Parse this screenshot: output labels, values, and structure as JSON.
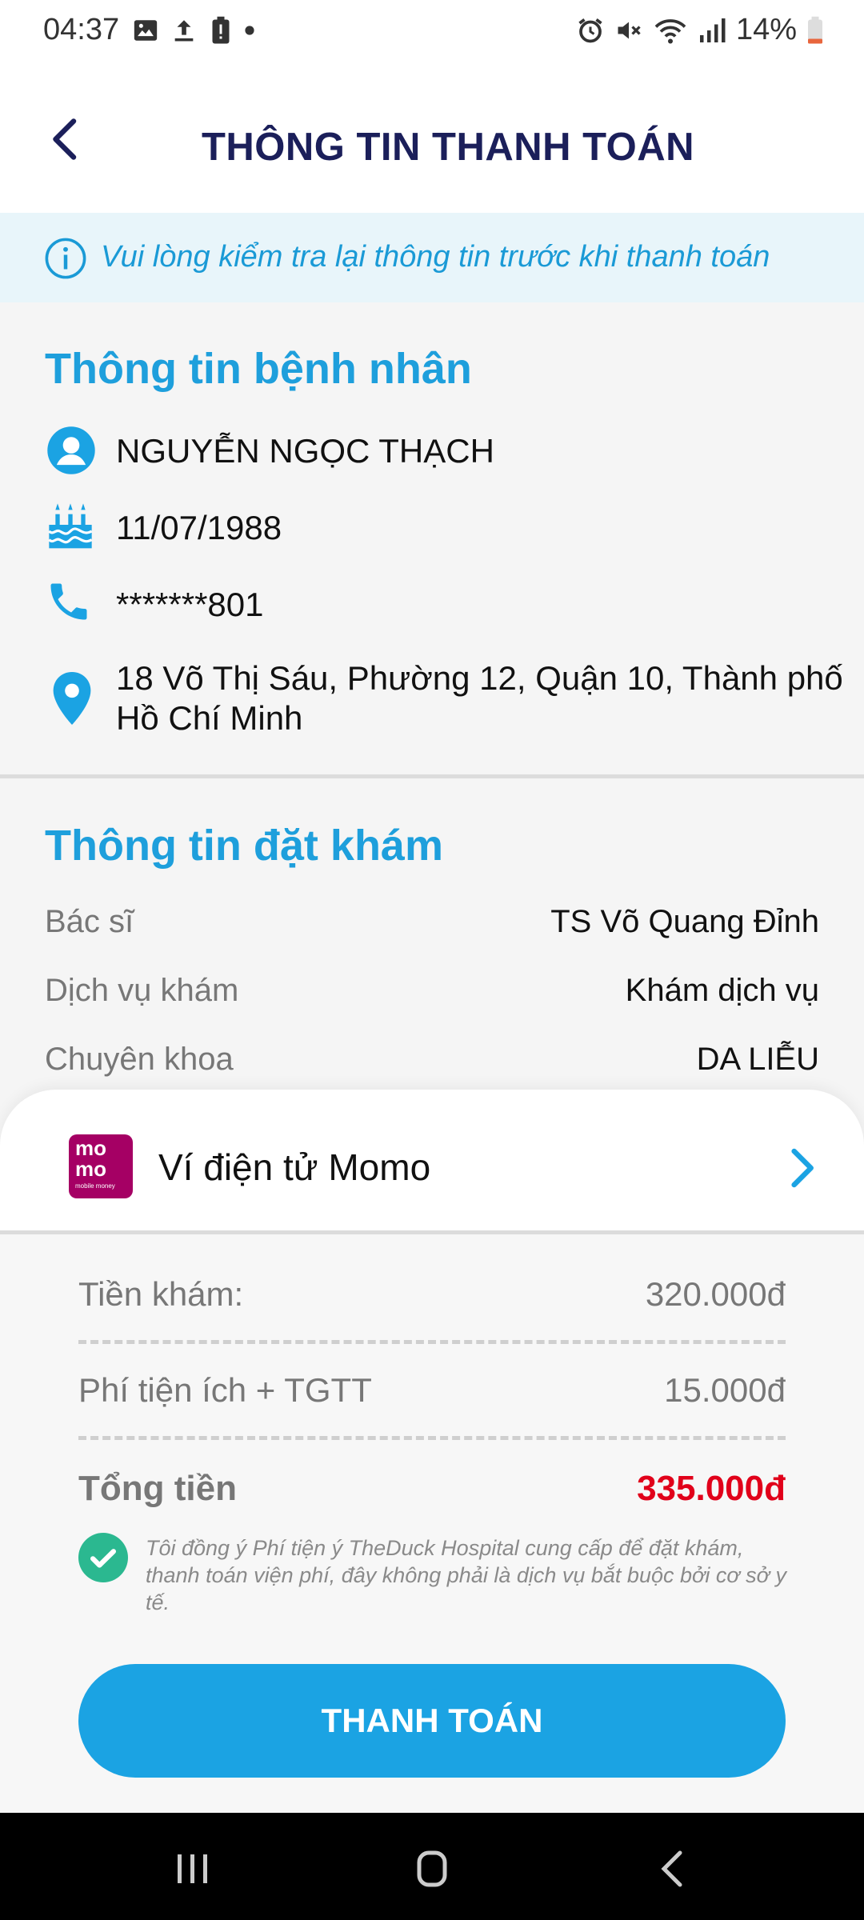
{
  "status_bar": {
    "time": "04:37",
    "battery_percent": "14%",
    "icons_left": [
      "image-icon",
      "upload-icon",
      "battery-alert-icon",
      "dot-icon"
    ],
    "icons_right": [
      "alarm-icon",
      "mute-icon",
      "wifi-icon",
      "signal-icon",
      "battery-icon"
    ]
  },
  "header": {
    "title": "THÔNG TIN THANH TOÁN",
    "back_icon": "chevron-left-icon"
  },
  "notice": {
    "text": "Vui lòng kiểm tra lại thông tin trước khi thanh toán",
    "icon": "info-icon"
  },
  "patient": {
    "section_title": "Thông tin bệnh nhân",
    "name": "NGUYỄN NGỌC THẠCH",
    "dob": "11/07/1988",
    "phone": "*******801",
    "address_line1": "18 Võ Thị Sáu, Phường 12, Quận 10, Thành phố",
    "address_line2": "Hồ Chí Minh"
  },
  "booking": {
    "section_title": "Thông tin đặt khám",
    "rows": [
      {
        "label": "Bác sĩ",
        "value": "TS Võ Quang Đỉnh"
      },
      {
        "label": "Dịch vụ khám",
        "value": "Khám dịch vụ"
      },
      {
        "label": "Chuyên khoa",
        "value": "DA LIỄU"
      }
    ]
  },
  "payment_method": {
    "label": "Ví điện tử Momo",
    "logo_text_1": "mo",
    "logo_text_2": "mo",
    "logo_caption": "mobile money"
  },
  "fees": {
    "exam_label": "Tiền khám:",
    "exam_value": "320.000đ",
    "service_label": "Phí tiện ích + TGTT",
    "service_value": "15.000đ",
    "total_label": "Tổng tiền",
    "total_value": "335.000đ",
    "agreement": "Tôi đồng ý Phí tiện ý TheDuck Hospital cung cấp để đặt khám, thanh toán viện phí, đây không phải là dịch vụ bắt buộc bởi cơ sở y tế."
  },
  "action": {
    "pay_button": "THANH TOÁN"
  },
  "colors": {
    "accent": "#1e9fdc",
    "title_dark": "#1b1f5a",
    "total_red": "#e1001a",
    "check_green": "#2bb890",
    "momo_brand": "#a50064"
  }
}
